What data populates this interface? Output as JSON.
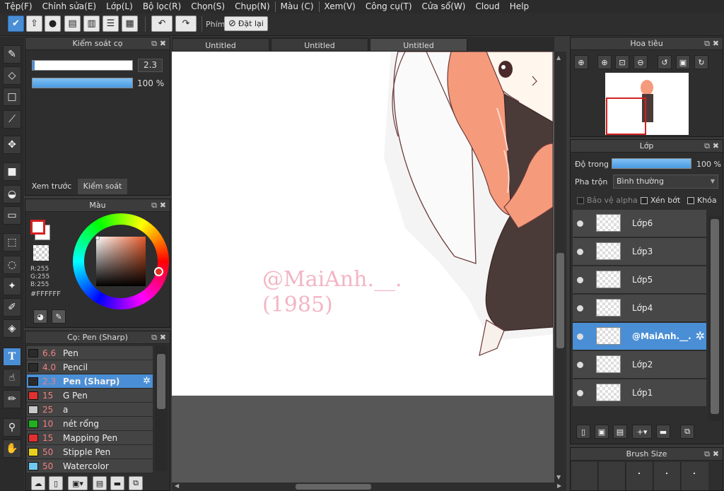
{
  "menu": [
    "Tệp(F)",
    "Chỉnh sửa(E)",
    "Lớp(L)",
    "Bộ lọc(R)",
    "Chọn(S)",
    "Chụp(N)",
    "Màu (C)",
    "Xem(V)",
    "Công cụ(T)",
    "Cửa sổ(W)",
    "Cloud",
    "Help"
  ],
  "toolbar": {
    "key_label": "Phím",
    "reset_label": "Đặt lại"
  },
  "brush_control": {
    "title": "Kiểm soát cọ",
    "size_value": "2.3",
    "size_fill": 0.02,
    "opacity_label": "100 %",
    "opacity_fill": 1.0,
    "tab_preview": "Xem trước cọ",
    "tab_control": "Kiểm soát cọ"
  },
  "color": {
    "title": "Màu",
    "r": "R:255",
    "g": "G:255",
    "b": "B:255",
    "hex": "#FFFFFF",
    "primary": "#ffffff",
    "primary_border": "#d42020"
  },
  "brushes": {
    "title": "Cọ: Pen (Sharp)",
    "items": [
      {
        "size": "6.6",
        "name": "Pen",
        "color": "#2b2b2b"
      },
      {
        "size": "4.0",
        "name": "Pencil",
        "color": "#2b2b2b"
      },
      {
        "size": "2.3",
        "name": "Pen (Sharp)",
        "color": "#2b2b2b"
      },
      {
        "size": "15",
        "name": "G Pen",
        "color": "#e03030"
      },
      {
        "size": "25",
        "name": "a",
        "color": "#c8c8c8"
      },
      {
        "size": "10",
        "name": "nét rổng",
        "color": "#20b020"
      },
      {
        "size": "15",
        "name": "Mapping Pen",
        "color": "#e03030"
      },
      {
        "size": "50",
        "name": "Stipple Pen",
        "color": "#e8d020"
      },
      {
        "size": "50",
        "name": "Watercolor",
        "color": "#70c8f0"
      }
    ]
  },
  "canvas": {
    "tabs": [
      "Untitled",
      "Untitled",
      "Untitled"
    ],
    "watermark_line1": "@MaiAnh.__.",
    "watermark_line2": "(1985)"
  },
  "navigator": {
    "title": "Hoa tiêu"
  },
  "layers": {
    "title": "Lớp",
    "opacity_label": "Độ trong",
    "opacity_value": "100 %",
    "opacity_fill": 1.0,
    "blend_label": "Pha trộn",
    "blend_value": "Bình thường",
    "protect_alpha": "Bảo vệ alpha",
    "clipping": "Xén bớt",
    "lock": "Khóa",
    "items": [
      "Lớp6",
      "Lớp3",
      "Lớp5",
      "Lớp4",
      "@MaiAnh.__.",
      "Lớp2",
      "Lớp1"
    ]
  },
  "brush_size": {
    "title": "Brush Size"
  }
}
